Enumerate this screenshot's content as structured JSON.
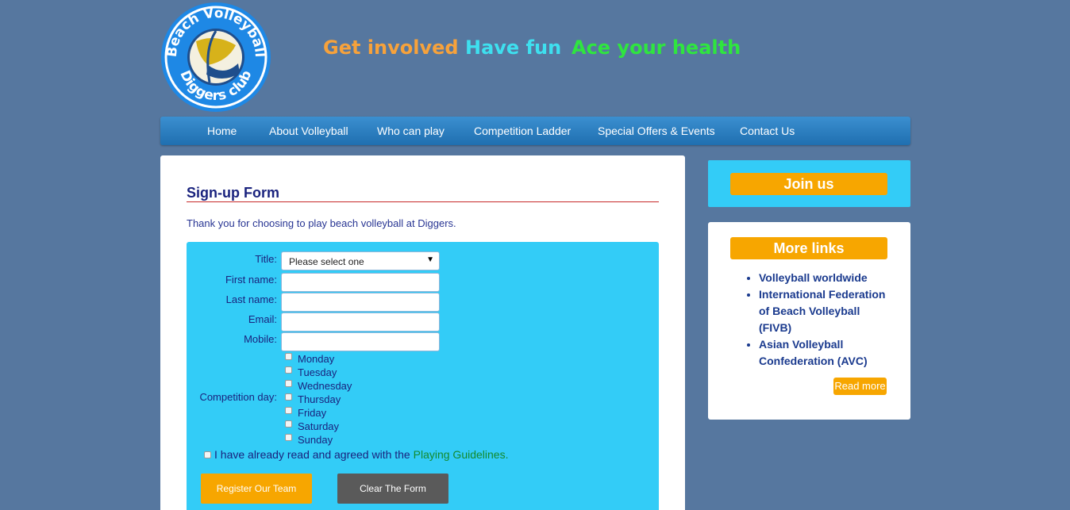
{
  "header": {
    "logo_text": "Beach Volleyball Diggers club",
    "taglines": [
      "Get involved",
      "Have fun",
      "Ace your health"
    ]
  },
  "nav": [
    "Home",
    "About Volleyball",
    "Who can play",
    "Competition Ladder",
    "Special Offers & Events",
    "Contact Us"
  ],
  "main": {
    "title": "Sign-up Form",
    "intro": "Thank you for choosing to play beach volleyball at Diggers.",
    "form": {
      "title_label": "Title:",
      "title_value": "Please select one",
      "first_name_label": "First name:",
      "last_name_label": "Last name:",
      "email_label": "Email:",
      "mobile_label": "Mobile:",
      "competition_label": "Competition day:",
      "days": [
        "Monday",
        "Tuesday",
        "Wednesday",
        "Thursday",
        "Friday",
        "Saturday",
        "Sunday"
      ],
      "agree_text": "I have already read and agreed with the",
      "agree_link": "Playing Guidelines.",
      "register_button": "Register Our Team",
      "clear_button": "Clear The Form"
    }
  },
  "sidebar": {
    "join_title": "Join us",
    "links_title": "More links",
    "links": [
      "Volleyball worldwide",
      "International Federation of Beach Volleyball (FIVB)",
      "Asian Volleyball Confederation (AVC)"
    ],
    "read_more": "Read more"
  },
  "colors": {
    "background": "#56779f",
    "accent_orange": "#f7a600",
    "form_blue": "#33ccf7",
    "nav_blue": "#2a7fc2"
  }
}
